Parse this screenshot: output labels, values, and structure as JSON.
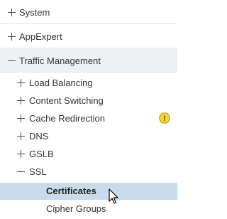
{
  "colors": {
    "expanded_row_bg": "#eef1f4",
    "selected_row_bg": "#c8dbea",
    "warning_fill": "#f7d733",
    "warning_stroke": "#c79a00",
    "text": "#333333"
  },
  "tree": {
    "top_items": [
      {
        "label": "System",
        "state": "collapsed"
      },
      {
        "label": "AppExpert",
        "state": "collapsed"
      },
      {
        "label": "Traffic Management",
        "state": "expanded"
      }
    ],
    "traffic_management_children": [
      {
        "label": "Load Balancing",
        "state": "collapsed"
      },
      {
        "label": "Content Switching",
        "state": "collapsed"
      },
      {
        "label": "Cache Redirection",
        "state": "collapsed",
        "icon": "warning-icon",
        "warning_glyph": "!"
      },
      {
        "label": "DNS",
        "state": "collapsed"
      },
      {
        "label": "GSLB",
        "state": "collapsed"
      },
      {
        "label": "SSL",
        "state": "expanded"
      }
    ],
    "ssl_children": [
      {
        "label": "Certificates",
        "selected": true
      },
      {
        "label": "Cipher Groups",
        "selected": false
      }
    ]
  },
  "cursor": {
    "icon": "mouse-pointer-icon"
  }
}
